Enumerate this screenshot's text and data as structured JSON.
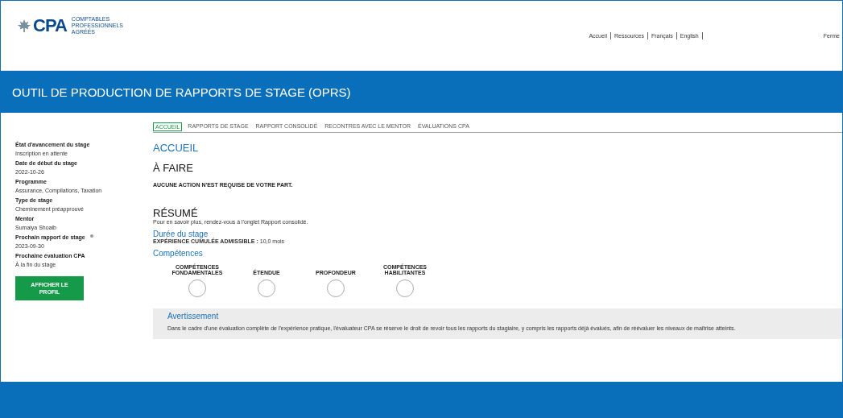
{
  "header": {
    "logo": {
      "mark": "CPA",
      "subtitle": [
        "COMPTABLES",
        "PROFESSIONNELS",
        "AGRÉÉS"
      ]
    },
    "links": [
      "Accueil",
      "Ressources",
      "Français",
      "English"
    ],
    "close": "Ferme"
  },
  "banner": {
    "title": "OUTIL DE PRODUCTION DE RAPPORTS DE STAGE (OPRS)"
  },
  "sidebar": {
    "fields": [
      {
        "label": "État d'avancement du stage",
        "value": "Inscription en attente",
        "info": false
      },
      {
        "label": "Date de début du stage",
        "value": "2022-10-26",
        "info": false
      },
      {
        "label": "Programme",
        "value": "Assurance, Compilations, Taxation",
        "info": false
      },
      {
        "label": "Type de stage",
        "value": "Cheminement préapprouvé",
        "info": false
      },
      {
        "label": "Mentor",
        "value": "Sumaiya Shoaib",
        "info": false
      },
      {
        "label": "Prochain rapport de stage",
        "value": "2023-09-30",
        "info": true
      },
      {
        "label": "Prochaine évaluation CPA",
        "value": "À la fin du stage",
        "info": false
      }
    ],
    "button": "AFFICHER LE PROFIL"
  },
  "tabs": [
    {
      "label": "ACCUEIL",
      "selected": true
    },
    {
      "label": "RAPPORTS DE STAGE",
      "selected": false
    },
    {
      "label": "RAPPORT CONSOLIDÉ",
      "selected": false
    },
    {
      "label": "RECONTRES AVEC LE MENTOR",
      "selected": false
    },
    {
      "label": "ÉVALUATIONS CPA",
      "selected": false
    }
  ],
  "page_title": "ACCUEIL",
  "todo": {
    "heading": "À FAIRE",
    "text": "AUCUNE ACTION N'EST REQUISE DE VOTRE PART."
  },
  "summary": {
    "heading": "RÉSUMÉ",
    "text": "Pour en savoir plus, rendez-vous à l'onglet Rapport consolidé.",
    "duration": {
      "heading": "Durée du stage",
      "label": "EXPÉRIENCE CUMULÉE ADMISSIBLE :",
      "value": "10,0 mois"
    },
    "competencies": {
      "heading": "Compétences",
      "items": [
        "COMPÉTENCES FONDAMENTALES",
        "ÉTENDUE",
        "PROFONDEUR",
        "COMPÉTENCES HABILITANTES"
      ]
    }
  },
  "warning": {
    "heading": "Avertissement",
    "text": "Dans le cadre d'une évaluation complète de l'expérience pratique, l'évaluateur CPA se réserve le droit de revoir tous les rapports du stagiaire, y compris les rapports déjà évalués, afin de réévaluer les niveaux de maîtrise atteints."
  }
}
